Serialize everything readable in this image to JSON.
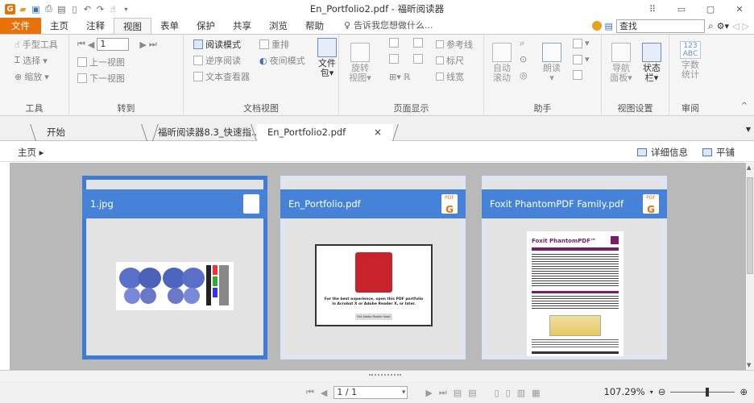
{
  "titlebar": {
    "title": "En_Portfolio2.pdf - 福昕阅读器"
  },
  "menu": {
    "file": "文件",
    "tabs": [
      "主页",
      "注释",
      "视图",
      "表单",
      "保护",
      "共享",
      "浏览",
      "帮助"
    ],
    "active": "视图",
    "tell_me": "告诉我您想做什么...",
    "search_placeholder": "查找"
  },
  "ribbon": {
    "tools": {
      "hand": "手型工具",
      "select": "选择",
      "zoom": "缩放",
      "label": "工具"
    },
    "goto": {
      "page_value": "1",
      "prev_view": "上一视图",
      "next_view": "下一视图",
      "label": "转到"
    },
    "docview": {
      "reading_mode": "阅读模式",
      "reflow": "重排",
      "reverse_reading": "逆序阅读",
      "night_mode": "夜间模式",
      "text_viewer": "文本查看器",
      "file_pkg": "文件",
      "file_pkg2": "包",
      "label": "文档视图"
    },
    "pagedisplay": {
      "rotate": "旋转",
      "rotate2": "视图",
      "ref_line": "参考线",
      "ruler": "标尺",
      "line_width": "线宽",
      "label": "页面显示"
    },
    "assistant": {
      "autoscroll": "自动",
      "autoscroll2": "滚动",
      "read": "朗读",
      "label": "助手"
    },
    "viewsettings": {
      "nav_panel": "导航",
      "nav_panel2": "面板",
      "status_bar": "状态",
      "status_bar2": "栏",
      "label": "视图设置"
    },
    "review": {
      "wordcount_icon": "123 ABC",
      "wordcount": "字数",
      "wordcount2": "统计",
      "label": "审阅"
    }
  },
  "doctabs": [
    {
      "label": "开始"
    },
    {
      "label": "福昕阅读器8.3_快速指..."
    },
    {
      "label": "En_Portfolio2.pdf",
      "close": "×"
    }
  ],
  "crumb": {
    "home": "主页 ▸",
    "details": "详细信息",
    "tile": "平铺"
  },
  "portfolio": [
    {
      "name": "1.jpg",
      "icon": "image-file-icon"
    },
    {
      "name": "En_Portfolio.pdf",
      "icon": "pdf-file-icon",
      "thumb_text": "For the best experience, open this PDF portfolio in Acrobat X or Adobe Reader X, or later.",
      "thumb_button": "Get Adobe Reader Now!"
    },
    {
      "name": "Foxit PhantomPDF Family.pdf",
      "icon": "pdf-file-icon",
      "thumb_title": "Foxit PhantomPDF™"
    }
  ],
  "statusbar": {
    "page": "1 / 1",
    "zoom": "107.29%"
  }
}
